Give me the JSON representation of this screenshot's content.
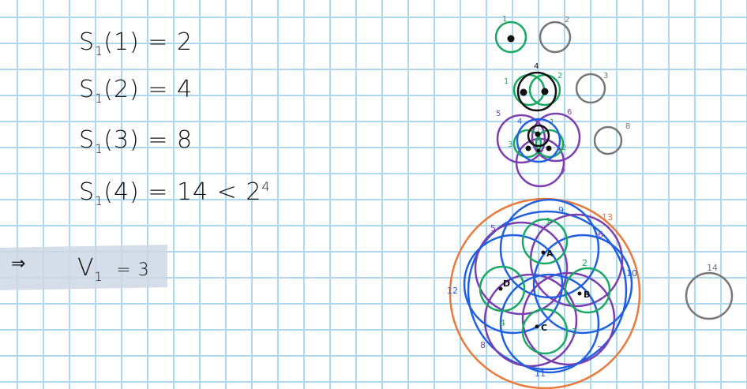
{
  "equations": [
    {
      "main": "S",
      "sub": "1",
      "rest": "(1) = 2"
    },
    {
      "main": "S",
      "sub": "1",
      "rest": "(2) = 4"
    },
    {
      "main": "S",
      "sub": "1",
      "rest": "(3) = 8"
    },
    {
      "main": "S",
      "sub": "1",
      "rest": "(4) = 14 < 2",
      "sup": "4"
    }
  ],
  "conclusion": {
    "arrow": "⇒",
    "main": "V",
    "sub": "1",
    "rest": "= 3"
  },
  "colors": {
    "green": "#1aa864",
    "grey": "#777777",
    "purple": "#7b3fb0",
    "blue": "#1f5fe0",
    "orange": "#ea7a3c",
    "black": "#111111"
  },
  "labels": {
    "d1": {
      "a": "1",
      "b": "2"
    },
    "d2": {
      "a": "1",
      "b": "2",
      "c": "4",
      "d": "3"
    },
    "d3": {
      "a": "5",
      "b": "4",
      "c": "1",
      "d": "6",
      "e": "3",
      "f": "2",
      "g": "7",
      "h": "8"
    },
    "d4": {
      "n9": "9",
      "n13": "13",
      "n1": "1",
      "n5": "5",
      "n6": "6",
      "n2": "2",
      "n12": "12",
      "n10": "10",
      "n3": "3",
      "n4": "4",
      "n8": "8",
      "n7": "7",
      "n11": "11",
      "A": "A",
      "B": "B",
      "C": "C",
      "D": "D"
    },
    "far": "14"
  }
}
